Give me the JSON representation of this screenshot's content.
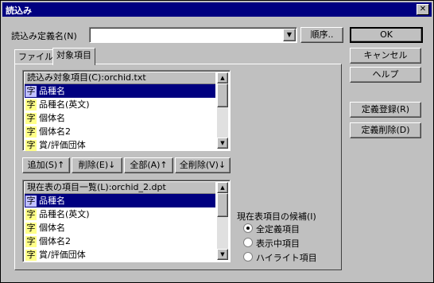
{
  "title": "読込み",
  "close_glyph": "✕",
  "definition_label": "読込み定義名(N)",
  "definition_value": "",
  "order_button": "順序..",
  "buttons": {
    "ok": "OK",
    "cancel": "キャンセル",
    "help": "ヘルプ",
    "register": "定義登録(R)",
    "delete_def": "定義削除(D)"
  },
  "tabs": [
    {
      "label": "ファイル",
      "active": false
    },
    {
      "label": "対象項目",
      "active": true
    }
  ],
  "source_list": {
    "header": "読込み対象項目(C):orchid.txt",
    "items": [
      {
        "badge": "字",
        "label": "品種名",
        "selected": true
      },
      {
        "badge": "字",
        "label": "品種名(英文)",
        "selected": false
      },
      {
        "badge": "字",
        "label": "個体名",
        "selected": false
      },
      {
        "badge": "字",
        "label": "個体名2",
        "selected": false
      },
      {
        "badge": "字",
        "label": "賞/評価団体",
        "selected": false
      }
    ]
  },
  "action_buttons": {
    "add": "追加(S)↑",
    "remove": "削除(E)↓",
    "all": "全部(A)↑",
    "remove_all": "全削除(V)↓"
  },
  "target_list": {
    "header": "現在表の項目一覧(L):orchid_2.dpt",
    "items": [
      {
        "badge": "字",
        "label": "品種名",
        "selected": true
      },
      {
        "badge": "字",
        "label": "品種名(英文)",
        "selected": false
      },
      {
        "badge": "字",
        "label": "個体名",
        "selected": false
      },
      {
        "badge": "字",
        "label": "個体名2",
        "selected": false
      },
      {
        "badge": "字",
        "label": "賞/評価団体",
        "selected": false
      }
    ]
  },
  "candidates": {
    "label": "現在表項目の候補(I)",
    "options": [
      {
        "label": "全定義項目",
        "checked": true
      },
      {
        "label": "表示中項目",
        "checked": false
      },
      {
        "label": "ハイライト項目",
        "checked": false
      }
    ]
  }
}
